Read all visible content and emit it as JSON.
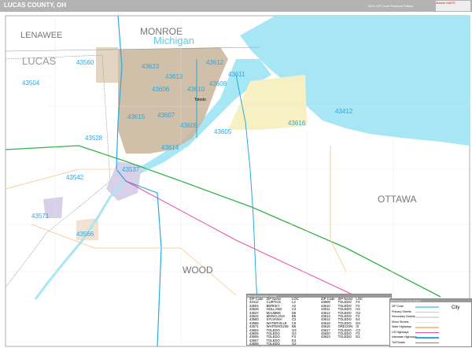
{
  "header": {
    "title": "LUCAS COUNTY, OH",
    "edition": "2021 ZIP Code Premium Edition",
    "logo_text": "Market MAPS"
  },
  "map": {
    "regions": [
      "LENAWEE",
      "MONROE",
      "Michigan",
      "LUCAS",
      "WOOD",
      "OTTAWA"
    ],
    "city_label": "Toledo",
    "zip_labels": [
      {
        "zip": "43560"
      },
      {
        "zip": "43623"
      },
      {
        "zip": "43612"
      },
      {
        "zip": "43504"
      },
      {
        "zip": "43613"
      },
      {
        "zip": "43611"
      },
      {
        "zip": "43606"
      },
      {
        "zip": "43608"
      },
      {
        "zip": "43610"
      },
      {
        "zip": "43615"
      },
      {
        "zip": "43607"
      },
      {
        "zip": "43609"
      },
      {
        "zip": "43605"
      },
      {
        "zip": "43616"
      },
      {
        "zip": "43412"
      },
      {
        "zip": "43528"
      },
      {
        "zip": "43614"
      },
      {
        "zip": "43537"
      },
      {
        "zip": "43542"
      },
      {
        "zip": "43571"
      },
      {
        "zip": "43566"
      }
    ],
    "colors": {
      "water": "#a6e6f5",
      "zip_label": "#29a9e0",
      "toledo_area": "#c8b49a",
      "oregon_area": "#f7f0c2",
      "maumee_area": "#d8cfe8",
      "interstate": "#31b24a",
      "us_highway": "#e94fa8"
    }
  },
  "zip_table": {
    "title": "ZIP Code Index/Grid Locator",
    "columns": [
      "ZIP Code",
      "ZIP Name",
      "LOC"
    ],
    "left": [
      [
        "43412",
        "CURTICE",
        "L3"
      ],
      [
        "43504",
        "BERKEY",
        "A2"
      ],
      [
        "43528",
        "HOLLAND",
        "C4"
      ],
      [
        "43537",
        "MAUMEE",
        "D5"
      ],
      [
        "43542",
        "MONCLOVA",
        "B5"
      ],
      [
        "43560",
        "SYLVANIA",
        "C2"
      ],
      [
        "43566",
        "WATERVILLE",
        "C6"
      ],
      [
        "43571",
        "WHITEHOUSE",
        "B6"
      ],
      [
        "43604",
        "TOLEDO",
        "G3"
      ],
      [
        "43605",
        "TOLEDO",
        "G3"
      ],
      [
        "43606",
        "TOLEDO",
        "F3"
      ],
      [
        "43607",
        "TOLEDO",
        "E3"
      ],
      [
        "43608",
        "TOLEDO",
        "G2"
      ]
    ],
    "right": [
      [
        "43609",
        "TOLEDO",
        "F4"
      ],
      [
        "43610",
        "TOLEDO",
        "F2"
      ],
      [
        "43611",
        "TOLEDO",
        "H2"
      ],
      [
        "43612",
        "TOLEDO",
        "G2"
      ],
      [
        "43613",
        "TOLEDO",
        "F2"
      ],
      [
        "43614",
        "TOLEDO",
        "E4"
      ],
      [
        "43615",
        "TOLEDO",
        "D3"
      ],
      [
        "43616",
        "OREGON",
        "I3"
      ],
      [
        "43617",
        "TOLEDO",
        "C3"
      ],
      [
        "43620",
        "TOLEDO",
        "F3"
      ],
      [
        "43623",
        "TOLEDO",
        "E2"
      ]
    ]
  },
  "legend": {
    "title": "2019 Census County Legend",
    "items": [
      "ZIP Code",
      "Primary Streets",
      "Secondary Streets",
      "Minor Streets",
      "State Highways",
      "US Highways",
      "Interstate Highways",
      "Toll Roads"
    ],
    "city_title": "City",
    "colors": [
      "#7fd8f0",
      "#cccccc",
      "#dddddd",
      "#eeeeee",
      "#f5c48a",
      "#e94fa8",
      "#29a9e0",
      "#31b24a"
    ]
  }
}
